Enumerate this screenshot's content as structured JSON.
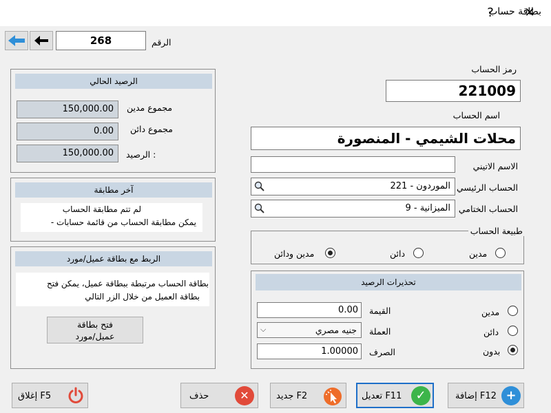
{
  "window": {
    "title": "بطاقة حساب",
    "help": "?",
    "close": "✕"
  },
  "nav": {
    "number_label": "الرقم",
    "number_value": "268"
  },
  "account": {
    "code_label": "رمز الحساب",
    "code_value": "221009",
    "name_label": "اسم الحساب",
    "name_value": "محلات الشيمي - المنصورة",
    "latin_label": "الاسم الاتيني",
    "latin_value": "",
    "parent_label": "الحساب الرئيسي",
    "parent_value": "221 - الموردون",
    "final_label": "الحساب الختامي",
    "final_value": "9 - الميزانية"
  },
  "nature": {
    "title": "طبيعة الحساب",
    "options": [
      "مدين",
      "دائن",
      "مدين ودائن"
    ],
    "selected": "مدين ودائن"
  },
  "warnings": {
    "title": "تحذيرات الرصيد",
    "options": [
      "مدين",
      "دائن",
      "بدون"
    ],
    "selected": "بدون",
    "value_label": "القيمة",
    "value": "0.00",
    "currency_label": "العملة",
    "currency": "جنيه مصري",
    "rate_label": "الصرف",
    "rate": "1.00000"
  },
  "balance": {
    "title": "الرصيد الحالي",
    "debit_label": "مجموع مدين",
    "debit": "150,000.00",
    "credit_label": "مجموع دائن",
    "credit": "0.00",
    "balance_label": "الرصيد :",
    "balance": "150,000.00"
  },
  "matching": {
    "title": "آخر مطابقة",
    "line1": "لم تتم مطابقة الحساب",
    "line2": "- يمكن مطابقة الحساب من قائمة حسابات"
  },
  "link": {
    "title": "الربط مع بطاقة عميل/مورد",
    "text1": "بطاقة الحساب مرتبطة ببطاقة عميل، يمكن فتح",
    "text2": "بطاقة العميل من خلال الزر التالي",
    "open_line1": "فتح بطاقة",
    "open_line2": "عميل/مورد"
  },
  "buttons": {
    "add": "إضافة F12",
    "edit": "تعديل F11",
    "new": "جديد F2",
    "delete": "حذف",
    "close": "إغلاق F5"
  },
  "colors": {
    "accent_blue": "#2f8fd8",
    "header_bg": "#c9d6e3",
    "green": "#3cb54a",
    "red": "#e14a3a",
    "orange": "#ee6d2a"
  }
}
